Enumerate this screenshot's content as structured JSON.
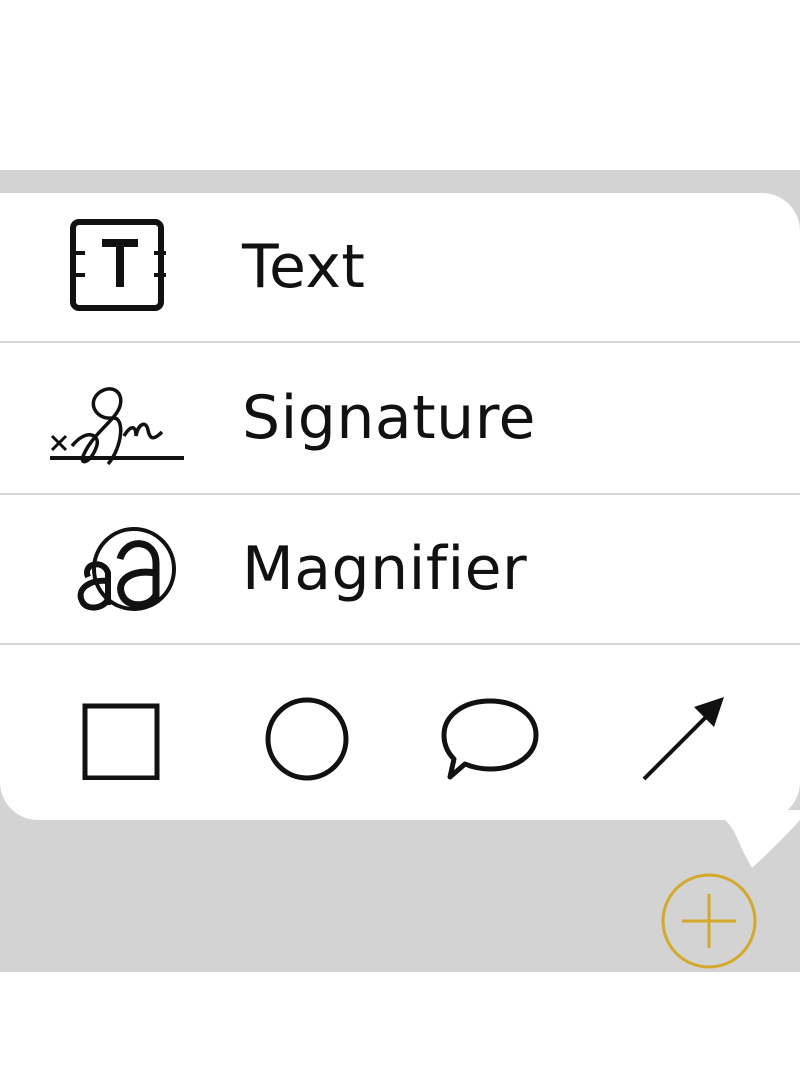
{
  "menu": {
    "items": [
      {
        "label": "Text",
        "icon": "text-box-icon"
      },
      {
        "label": "Signature",
        "icon": "signature-icon"
      },
      {
        "label": "Magnifier",
        "icon": "magnifier-icon"
      }
    ]
  },
  "shapes": [
    {
      "icon": "square-shape-icon"
    },
    {
      "icon": "circle-shape-icon"
    },
    {
      "icon": "speech-bubble-shape-icon"
    },
    {
      "icon": "arrow-shape-icon"
    }
  ],
  "add_button": {
    "icon": "plus-circle-icon"
  },
  "colors": {
    "backdrop": "#d3d3d3",
    "popover": "#ffffff",
    "divider": "#d6d6d6",
    "accent": "#d4a82a",
    "icon": "#111111"
  }
}
